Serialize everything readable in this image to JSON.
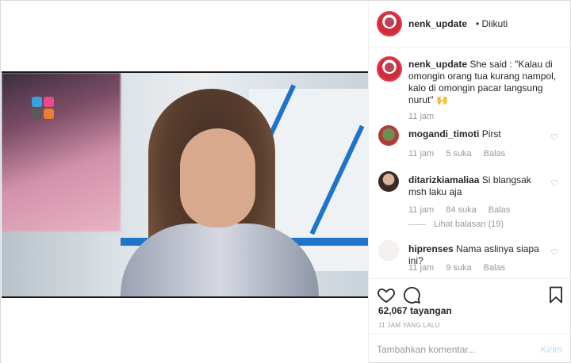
{
  "post": {
    "username": "nenk_update",
    "follow_status": "• Diikuti"
  },
  "caption": {
    "username": "nenk_update",
    "text": "She said : \"Kalau di omongin orang tua kurang nampol, kalo di omongin pacar langsung nurut\" 🙌",
    "time": "11 jam"
  },
  "comments": [
    {
      "username": "mogandi_timoti",
      "text": "Pirst",
      "time": "11 jam",
      "likes": "5 suka",
      "reply": "Balas",
      "avatar_color": "#6d8f4e"
    },
    {
      "username": "ditarizkiamaliaa",
      "text": "Si blangsak msh laku aja",
      "time": "11 jam",
      "likes": "84 suka",
      "reply": "Balas",
      "avatar_color": "#7a5a52",
      "view_replies": "Lihat balasan (19)"
    },
    {
      "username": "hiprenses",
      "text": "Nama aslinya siapa ini?",
      "time": "11 jam",
      "likes": "9 suka",
      "reply": "Balas",
      "avatar_color": "#f3ece9"
    }
  ],
  "stats": {
    "views": "62,067 tayangan",
    "posted": "11 JAM YANG LALU"
  },
  "composer": {
    "placeholder": "Tambahkan komentar...",
    "send_label": "Kirim"
  },
  "icons": [
    "heart-icon",
    "comment-icon",
    "bookmark-icon"
  ],
  "colors": {
    "accent_blue": "#1f74c9",
    "link_disabled": "#b2dffc"
  }
}
